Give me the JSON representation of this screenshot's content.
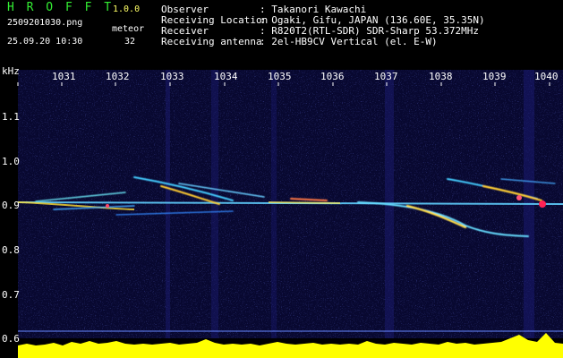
{
  "header": {
    "app_name": "H R O F F T",
    "version": "1.0.0",
    "filename": "2509201030.png",
    "datetime": "25.09.20 10:30",
    "count_label": "meteor",
    "count_value": "32",
    "info": [
      {
        "label": "Observer",
        "value": ": Takanori Kawachi"
      },
      {
        "label": "Receiving Location",
        "value": ": Ogaki, Gifu, JAPAN (136.60E, 35.35N)"
      },
      {
        "label": "Receiver",
        "value": ": R820T2(RTL-SDR) SDR-Sharp 53.372MHz"
      },
      {
        "label": "Receiving antenna",
        "value": ": 2el-HB9CV Vertical (el. E-W)"
      }
    ]
  },
  "axes": {
    "y_unit": "kHz",
    "y_ticks": [
      "1.1",
      "1.0",
      "0.9",
      "0.8",
      "0.7",
      "0.6"
    ],
    "x_ticks": [
      "1031",
      "1032",
      "1033",
      "1034",
      "1035",
      "1036",
      "1037",
      "1038",
      "1039",
      "1040"
    ]
  },
  "colors": {
    "background": "#000000",
    "plot_background": "#0a0a3a",
    "header_green": "#33ee33",
    "amplitude_bar": "#ffff00",
    "cyan_strip": "#00ccff"
  }
}
